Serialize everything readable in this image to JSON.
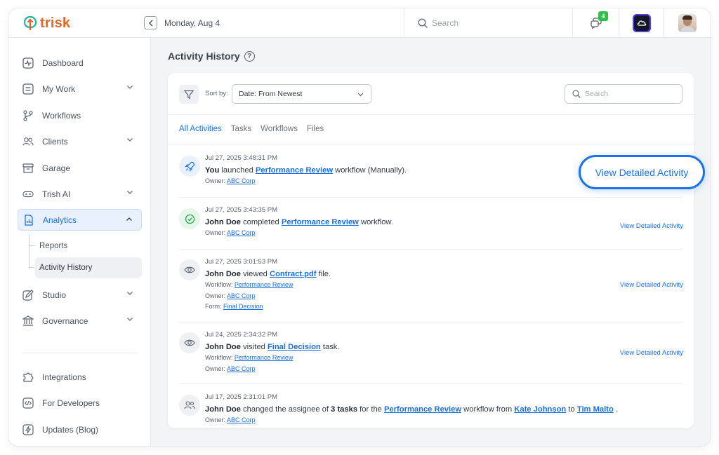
{
  "app": {
    "logo_text": "trisk",
    "date": "Monday, Aug 4",
    "search_placeholder": "Search",
    "notifications_count": "4"
  },
  "sidebar": {
    "items": [
      {
        "label": "Dashboard",
        "icon": "pulse-icon"
      },
      {
        "label": "My Work",
        "icon": "work-icon"
      },
      {
        "label": "Workflows",
        "icon": "workflow-icon"
      },
      {
        "label": "Clients",
        "icon": "users-icon"
      },
      {
        "label": "Garage",
        "icon": "archive-icon"
      },
      {
        "label": "Trish AI",
        "icon": "ai-icon"
      },
      {
        "label": "Analytics",
        "icon": "analytics-icon"
      },
      {
        "label": "Studio",
        "icon": "edit-icon"
      },
      {
        "label": "Governance",
        "icon": "bank-icon"
      },
      {
        "label": "Integrations",
        "icon": "puzzle-icon"
      },
      {
        "label": "For Developers",
        "icon": "code-icon"
      },
      {
        "label": "Updates (Blog)",
        "icon": "bolt-icon"
      }
    ],
    "analytics_sub": [
      "Reports",
      "Activity History"
    ]
  },
  "page": {
    "title": "Activity History",
    "help": "?"
  },
  "toolbar": {
    "sort_label": "Sort by:",
    "sort_value": "Date: From Newest",
    "search_placeholder": "Search"
  },
  "tabs": [
    "All Activities",
    "Tasks",
    "Workflows",
    "Files"
  ],
  "activities": [
    {
      "time": "Jul 27, 2025 3:48:31 PM",
      "actor": "You",
      "pre": " launched ",
      "link": "Performance Review",
      "post": " workflow (Manually).",
      "meta": [
        {
          "label": "Owner:",
          "value": "ABC Corp"
        }
      ],
      "action": "View Detailed Activity"
    },
    {
      "time": "Jul 27, 2025 3:43:35 PM",
      "actor": "John Doe",
      "pre": " completed ",
      "link": "Performance Review",
      "post": " workflow.",
      "meta": [
        {
          "label": "Owner:",
          "value": "ABC Corp"
        }
      ],
      "action": "View Detailed Activity"
    },
    {
      "time": "Jul 27, 2025 3:01:53 PM",
      "actor": "John Doe",
      "pre": " viewed ",
      "link": "Contract.pdf",
      "post": " file.",
      "meta": [
        {
          "label": "Workflow:",
          "value": "Performance Review"
        },
        {
          "label": "Owner:",
          "value": "ABC Corp"
        },
        {
          "label": "Form:",
          "value": "Final Decision"
        }
      ],
      "action": "View Detailed Activity"
    },
    {
      "time": "Jul 24, 2025 2:34:32 PM",
      "actor": "John Doe",
      "pre": " visited ",
      "link": "Final Decision",
      "post": " task.",
      "meta": [
        {
          "label": "Workflow:",
          "value": "Performance Review"
        },
        {
          "label": "Owner:",
          "value": "ABC Corp"
        }
      ],
      "action": "View Detailed Activity"
    },
    {
      "time": "Jul 17, 2025 2:31:01 PM",
      "actor": "John Doe",
      "pre": " changed the assignee of ",
      "count": "3 tasks",
      "mid": " for the ",
      "link": "Performance Review",
      "mid2": " workflow from ",
      "from": "Kate Johnson",
      "to_word": " to ",
      "to": "Tim Malto",
      "post": " .",
      "meta": [
        {
          "label": "Owner:",
          "value": "ABC Corp"
        }
      ]
    }
  ],
  "callout": "View Detailed Activity",
  "colors": {
    "accent": "#1a73e8",
    "brand": "#e4672a",
    "success": "#2fbf4a"
  }
}
